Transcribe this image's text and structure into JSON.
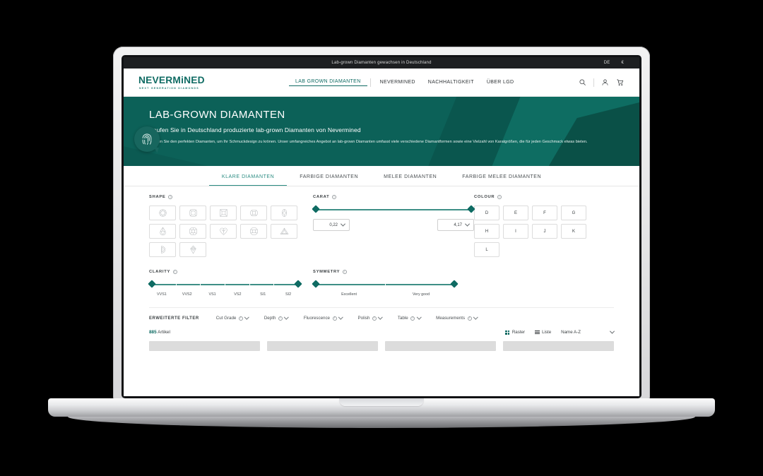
{
  "topbar": {
    "promo": "Lab-grown Diamanten gewachsen in Deutschland",
    "language": "DE",
    "currency": "€"
  },
  "brand": {
    "name": "NEVERMiNED",
    "tagline": "NEXT GENERATION DIAMONDS"
  },
  "nav": {
    "items": [
      {
        "label": "LAB GROWN DIAMANTEN",
        "active": true
      },
      {
        "label": "NEVERMINED",
        "active": false
      },
      {
        "label": "NACHHALTIGKEIT",
        "active": false
      },
      {
        "label": "ÜBER LGD",
        "active": false
      }
    ],
    "icons": [
      "search-icon",
      "account-icon",
      "cart-icon"
    ]
  },
  "hero": {
    "title": "LAB-GROWN DIAMANTEN",
    "subtitle": "Kaufen Sie in Deutschland produzierte lab-grown Diamanten von Nevermined",
    "body": "Wählen Sie den perfekten Diamanten, um Ihr Schmuckdesign zu krönen. Unser umfangreiches Angebot an lab-grown Diamanten umfasst viele verschiedene Diamantformen sowie eine Vielzahl von Karatgrößen, die für jeden Geschmack etwas bieten.",
    "bg_color": "#0c6158"
  },
  "tabs": [
    {
      "label": "KLARE DIAMANTEN",
      "active": true
    },
    {
      "label": "FARBIGE DIAMANTEN",
      "active": false
    },
    {
      "label": "MELEE DIAMANTEN",
      "active": false
    },
    {
      "label": "FARBIGE MELEE DIAMANTEN",
      "active": false
    }
  ],
  "filters": {
    "shape": {
      "label": "SHAPE",
      "options": [
        "round-shape-icon",
        "cushion-shape-icon",
        "princess-shape-icon",
        "emerald-shape-icon",
        "oval-shape-icon",
        "pear-shape-icon",
        "radiant-shape-icon",
        "heart-shape-icon",
        "asscher-shape-icon",
        "trillion-shape-icon",
        "halfmoon-shape-icon",
        "kite-shape-icon"
      ]
    },
    "carat": {
      "label": "CARAT",
      "min_value": "0,22",
      "max_value": "4,17"
    },
    "colour": {
      "label": "COLOUR",
      "options": [
        "D",
        "E",
        "F",
        "G",
        "H",
        "I",
        "J",
        "K",
        "L"
      ]
    },
    "clarity": {
      "label": "CLARITY",
      "steps": [
        "VVS1",
        "VVS2",
        "VS1",
        "VS2",
        "SI1",
        "SI2"
      ]
    },
    "symmetry": {
      "label": "SYMMETRY",
      "steps": [
        "Excellent",
        "Very good"
      ]
    }
  },
  "advanced": {
    "title": "ERWEITERTE FILTER",
    "items": [
      "Cut Grade",
      "Depth",
      "Fluorescence",
      "Polish",
      "Table",
      "Measurements"
    ]
  },
  "results": {
    "count": "885",
    "count_unit": "Artikel",
    "view_grid": "Raster",
    "view_list": "Liste",
    "sort": "Name A-Z"
  },
  "colors": {
    "brand_teal": "#0f6b63",
    "accent_teal": "#2b8c82",
    "hero_green": "#0c6158",
    "topbar_dark": "#1d1f21"
  }
}
